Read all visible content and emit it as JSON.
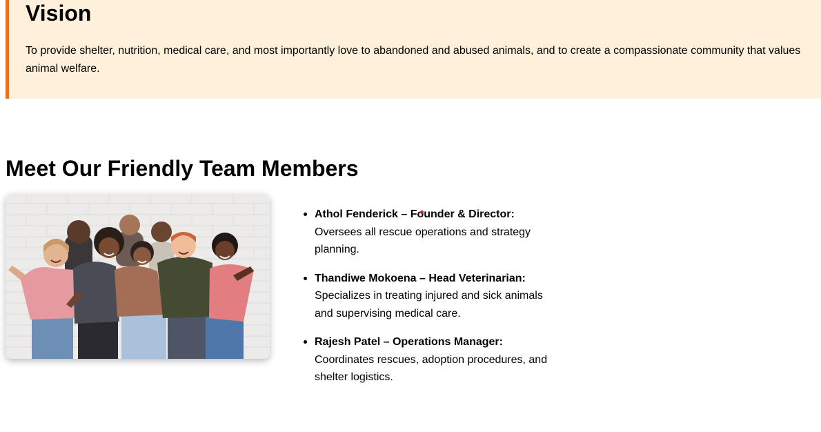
{
  "vision": {
    "heading": "Vision",
    "text": "To provide shelter, nutrition, medical care, and most importantly love to abandoned and abused animals, and to create a compassionate community that values animal welfare."
  },
  "team": {
    "heading": "Meet Our Friendly Team Members",
    "members": [
      {
        "name": "Athol Fenderick – Founder & Director:",
        "description": "Oversees all rescue operations and strategy planning."
      },
      {
        "name": "Thandiwe Mokoena – Head Veterinarian:",
        "description": "Specializes in treating injured and sick animals and supervising medical care."
      },
      {
        "name": "Rajesh Patel – Operations Manager:",
        "description": "Coordinates rescues, adoption procedures, and shelter logistics."
      }
    ]
  },
  "colors": {
    "vision_background": "#fff0dc",
    "vision_border_accent": "#e8731f",
    "cursor": "#d21e1e"
  }
}
